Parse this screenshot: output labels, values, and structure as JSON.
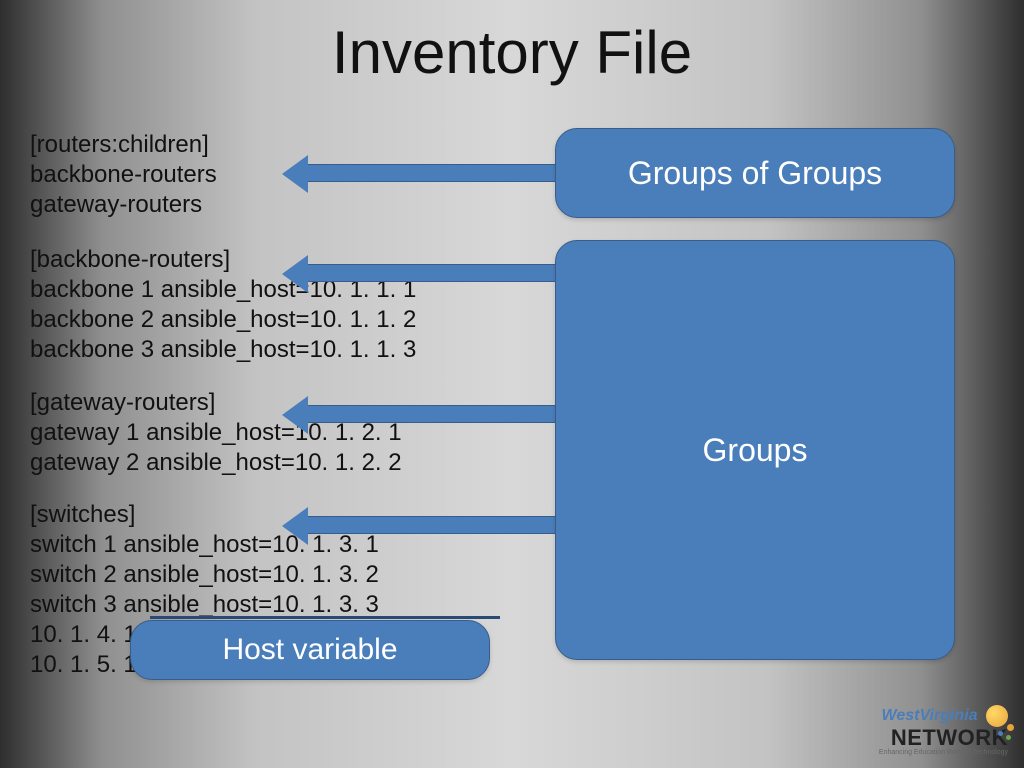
{
  "title": "Inventory File",
  "blocks": {
    "routers_children": {
      "header": "[routers:children]",
      "lines": [
        "backbone-routers",
        "gateway-routers"
      ]
    },
    "backbone": {
      "header": "[backbone-routers]",
      "lines": [
        "backbone 1  ansible_host=10. 1. 1. 1",
        "backbone 2  ansible_host=10. 1. 1. 2",
        "backbone 3  ansible_host=10. 1. 1. 3"
      ]
    },
    "gateway": {
      "header": "[gateway-routers]",
      "lines": [
        "gateway 1   ansible_host=10. 1. 2. 1",
        "gateway 2   ansible_host=10. 1. 2. 2"
      ]
    },
    "switches": {
      "header": "[switches]",
      "lines": [
        "switch 1    ansible_host=10. 1. 3. 1",
        "switch 2    ansible_host=10. 1. 3. 2",
        "switch 3    ansible_host=10. 1. 3. 3",
        "10. 1. 4. 1",
        "10. 1. 5. 1"
      ]
    }
  },
  "callouts": {
    "groups_of_groups": "Groups of Groups",
    "groups": "Groups",
    "host_variable": "Host variable"
  },
  "logo": {
    "line1": "WestVirginia",
    "line2": "NETWORK",
    "tagline": "Enhancing Education through Technology"
  }
}
